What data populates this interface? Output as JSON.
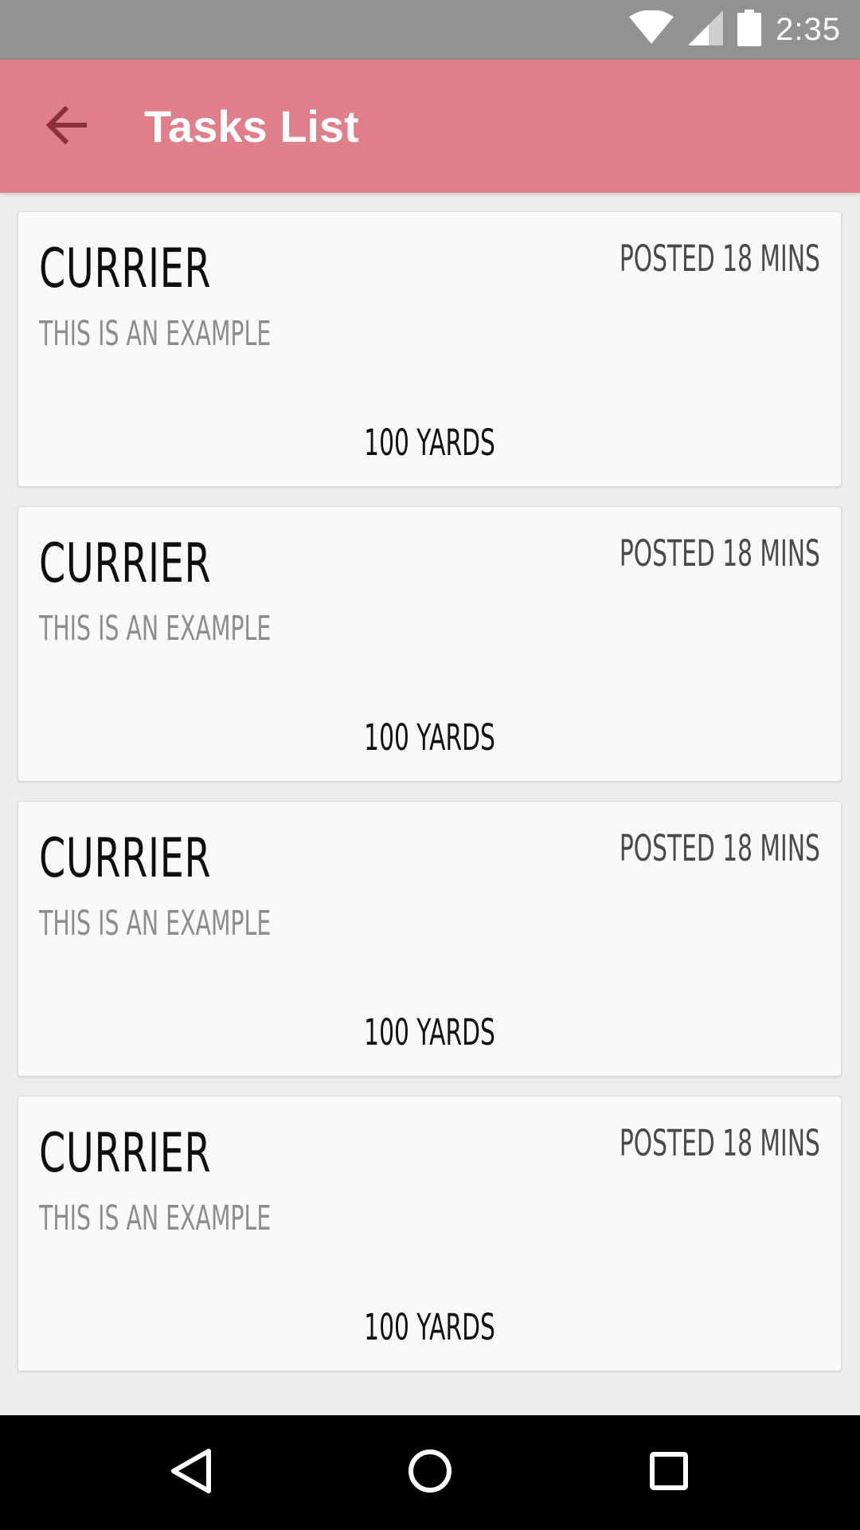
{
  "status_bar": {
    "time": "2:35",
    "icons": [
      "wifi-icon",
      "cell-signal-icon",
      "battery-icon"
    ]
  },
  "app_bar": {
    "title": "Tasks List",
    "back_icon": "arrow-back-icon",
    "color": "#de7f89"
  },
  "tasks": [
    {
      "title": "CURRIER",
      "subtitle": "THIS IS AN EXAMPLE",
      "posted": "POSTED 18 MINS",
      "distance": "100 YARDS"
    },
    {
      "title": "CURRIER",
      "subtitle": "THIS IS AN EXAMPLE",
      "posted": "POSTED 18 MINS",
      "distance": "100 YARDS"
    },
    {
      "title": "CURRIER",
      "subtitle": "THIS IS AN EXAMPLE",
      "posted": "POSTED 18 MINS",
      "distance": "100 YARDS"
    },
    {
      "title": "CURRIER",
      "subtitle": "THIS IS AN EXAMPLE",
      "posted": "POSTED 18 MINS",
      "distance": "100 YARDS"
    }
  ],
  "nav_bar": {
    "icons": [
      "back-triangle-icon",
      "home-circle-icon",
      "recents-square-icon"
    ]
  }
}
